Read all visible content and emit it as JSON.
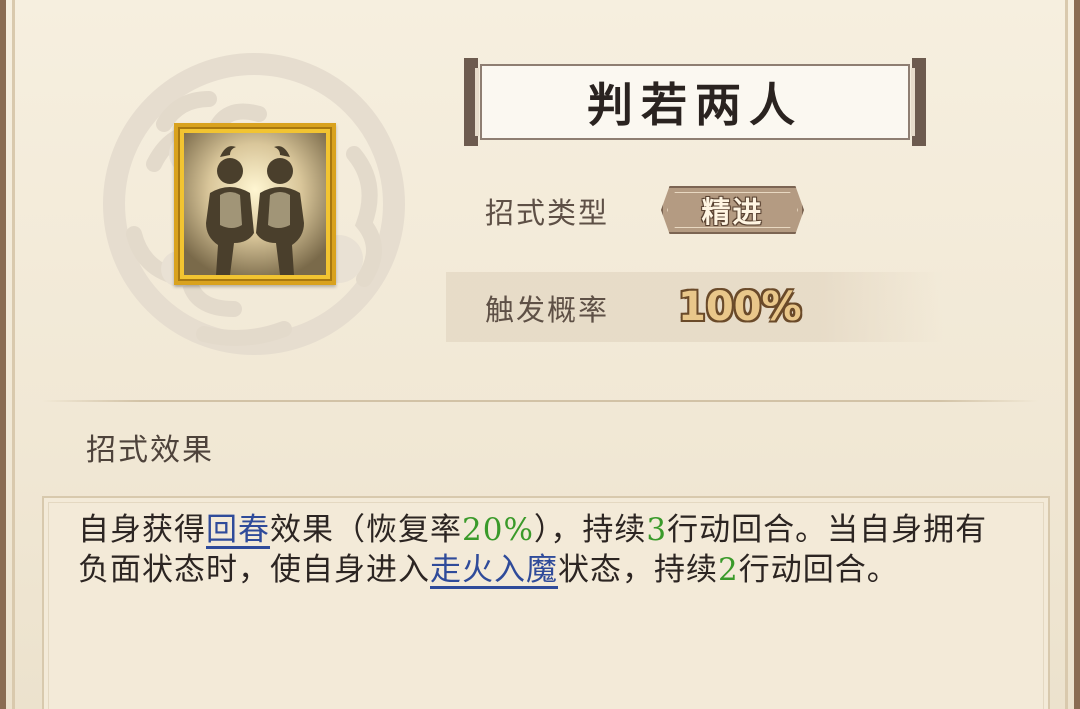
{
  "skill": {
    "name": "判若两人",
    "type_label": "招式类型",
    "type_value": "精进",
    "rate_label": "触发概率",
    "rate_value": "100%",
    "icon": "two-mirrored-warriors-icon"
  },
  "effect": {
    "heading": "招式效果",
    "segments": [
      {
        "t": "自身获得"
      },
      {
        "t": "回春",
        "kind": "link"
      },
      {
        "t": "效果（恢复率"
      },
      {
        "t": "20%",
        "kind": "num"
      },
      {
        "t": "），持续"
      },
      {
        "t": "3",
        "kind": "num"
      },
      {
        "t": "行动回合。当自身拥有负面状态时，使自身进入"
      },
      {
        "t": "走火入魔",
        "kind": "link"
      },
      {
        "t": "状态，持续"
      },
      {
        "t": "2",
        "kind": "num"
      },
      {
        "t": "行动回合。"
      }
    ]
  },
  "colors": {
    "keyword_link": "#2f4b9a",
    "number_highlight": "#3a9a2a",
    "icon_frame": "#d9a21e"
  }
}
